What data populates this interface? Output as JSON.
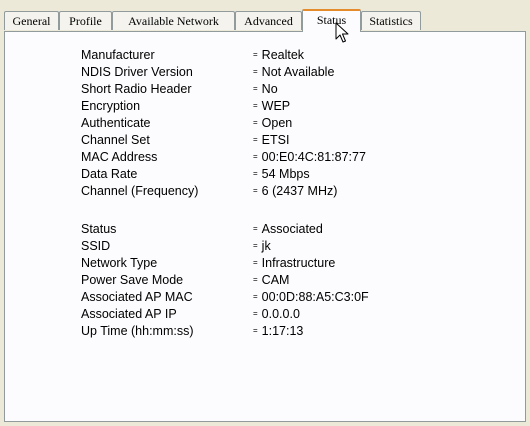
{
  "tabs": [
    {
      "label": "General",
      "active": false
    },
    {
      "label": "Profile",
      "active": false
    },
    {
      "label": "Available Network",
      "active": false
    },
    {
      "label": "Advanced",
      "active": false
    },
    {
      "label": "Status",
      "active": true
    },
    {
      "label": "Statistics",
      "active": false
    }
  ],
  "status": {
    "separator": "=",
    "adapter_info": [
      {
        "label": "Manufacturer",
        "value": "Realtek"
      },
      {
        "label": "NDIS Driver Version",
        "value": "Not Available"
      },
      {
        "label": "Short Radio Header",
        "value": "No"
      },
      {
        "label": "Encryption",
        "value": "WEP"
      },
      {
        "label": "Authenticate",
        "value": "Open"
      },
      {
        "label": "Channel Set",
        "value": "ETSI"
      },
      {
        "label": "MAC Address",
        "value": "00:E0:4C:81:87:77"
      },
      {
        "label": "Data Rate",
        "value": "54 Mbps"
      },
      {
        "label": "Channel (Frequency)",
        "value": "6 (2437 MHz)"
      }
    ],
    "connection_info": [
      {
        "label": "Status",
        "value": "Associated"
      },
      {
        "label": "SSID",
        "value": "jk"
      },
      {
        "label": "Network Type",
        "value": "Infrastructure"
      },
      {
        "label": "Power Save Mode",
        "value": "CAM"
      },
      {
        "label": "Associated AP MAC",
        "value": "00:0D:88:A5:C3:0F"
      },
      {
        "label": "Associated AP IP",
        "value": "0.0.0.0"
      },
      {
        "label": "Up Time (hh:mm:ss)",
        "value": "1:17:13"
      }
    ]
  },
  "colors": {
    "dialog_background": "#ece9d8",
    "panel_background": "#fcfcfe",
    "active_tab_highlight": "#e68b2c",
    "border": "#919b9c"
  },
  "icons": {
    "cursor": "mouse-pointer-icon"
  }
}
